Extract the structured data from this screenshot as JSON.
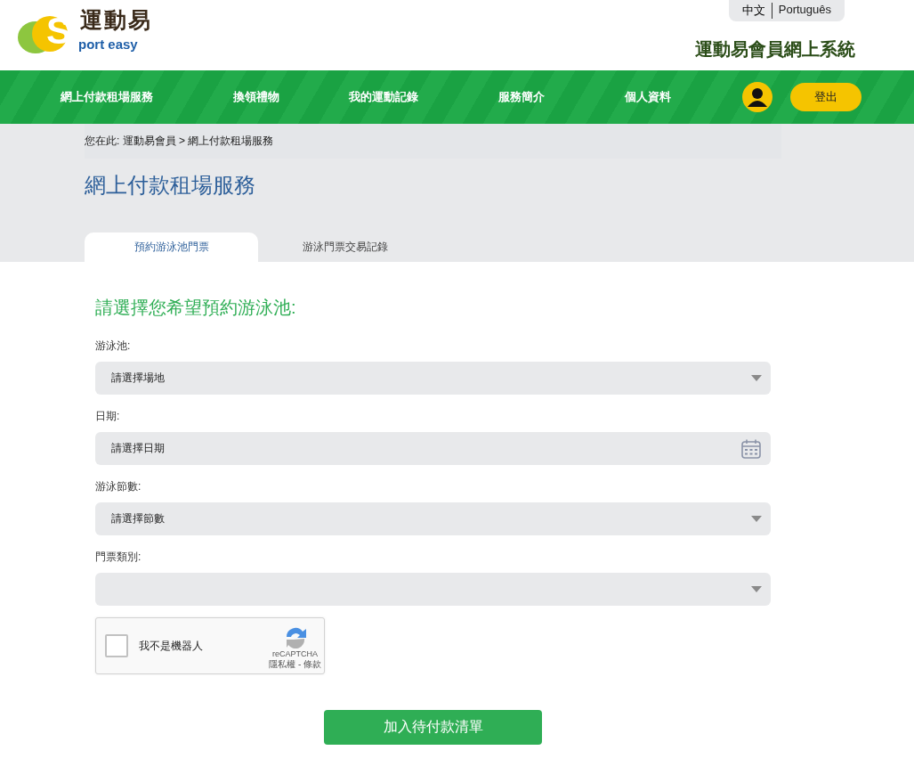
{
  "logo": {
    "mark": "運動易",
    "initial": "S",
    "wordmark": "port easy"
  },
  "languages": [
    {
      "label": "中文",
      "selected": true
    },
    {
      "label": "Português",
      "selected": false
    }
  ],
  "site_title": "運動易會員網上系統",
  "nav": {
    "items": [
      "網上付款租場服務",
      "換領禮物",
      "我的運動記錄",
      "服務簡介",
      "個人資料"
    ],
    "logout": "登出"
  },
  "breadcrumb": "您在此: 運動易會員 > 網上付款租場服務",
  "page_title": "網上付款租場服務",
  "tabs": [
    {
      "label": "預約游泳池門票",
      "selected": true
    },
    {
      "label": "游泳門票交易記錄",
      "selected": false
    }
  ],
  "form": {
    "heading": "請選擇您希望預約游泳池:",
    "fields": [
      {
        "label": "游泳池:",
        "kind": "select",
        "placeholder": "請選擇場地"
      },
      {
        "label": "日期:",
        "kind": "date",
        "placeholder": "請選擇日期"
      },
      {
        "label": "游泳節數:",
        "kind": "select",
        "placeholder": "請選擇節數"
      },
      {
        "label": "門票類別:",
        "kind": "select"
      }
    ],
    "captcha": {
      "label": "我不是機器人",
      "checked": false,
      "brand": "reCAPTCHA",
      "privacy": "隱私權",
      "separator": "-",
      "terms": "條款"
    },
    "submit": "加入待付款清單"
  }
}
